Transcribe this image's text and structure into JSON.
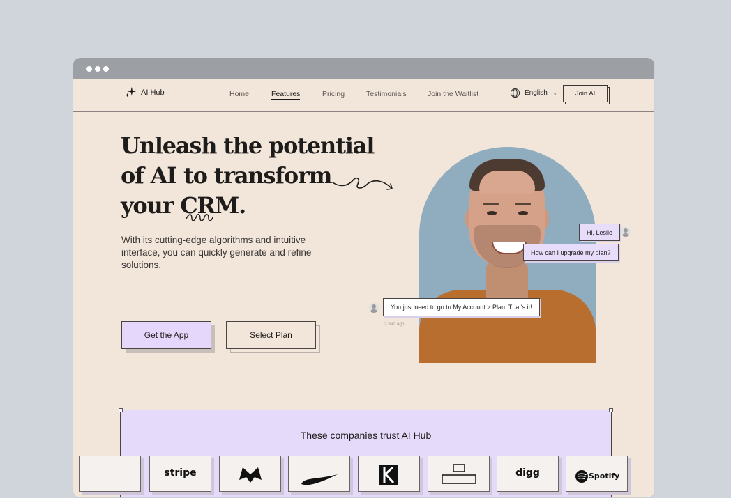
{
  "nav": {
    "logo_text": "AI Hub",
    "links": [
      {
        "label": "Home",
        "active": false
      },
      {
        "label": "Features",
        "active": true
      },
      {
        "label": "Pricing",
        "active": false
      },
      {
        "label": "Testimonials",
        "active": false
      },
      {
        "label": "Join the Waitlist",
        "active": false
      }
    ],
    "language": "English",
    "join_label": "Join AI"
  },
  "hero": {
    "title_lines": [
      "Unleash the potential",
      "of AI to transform",
      "your CRM."
    ],
    "subtitle": "With its cutting-edge algorithms and intuitive interface, you can quickly generate and refine solutions.",
    "primary_button": "Get the App",
    "secondary_button": "Select Plan"
  },
  "chat": {
    "greeting": "Hi, Leslie",
    "question": "How can I upgrade my plan?",
    "answer": "You just need to go to My Account > Plan. That's it!",
    "answer_time": "2 min ago"
  },
  "companies": {
    "title": "These companies trust AI Hub",
    "logos": [
      "stripe",
      "nike",
      "digg",
      "Spotify"
    ]
  },
  "colors": {
    "page_bg": "#f2e5da",
    "accent_purple": "#e5d6fb",
    "shirt": "#b86e2e",
    "portrait_bg": "#8fadbe"
  }
}
